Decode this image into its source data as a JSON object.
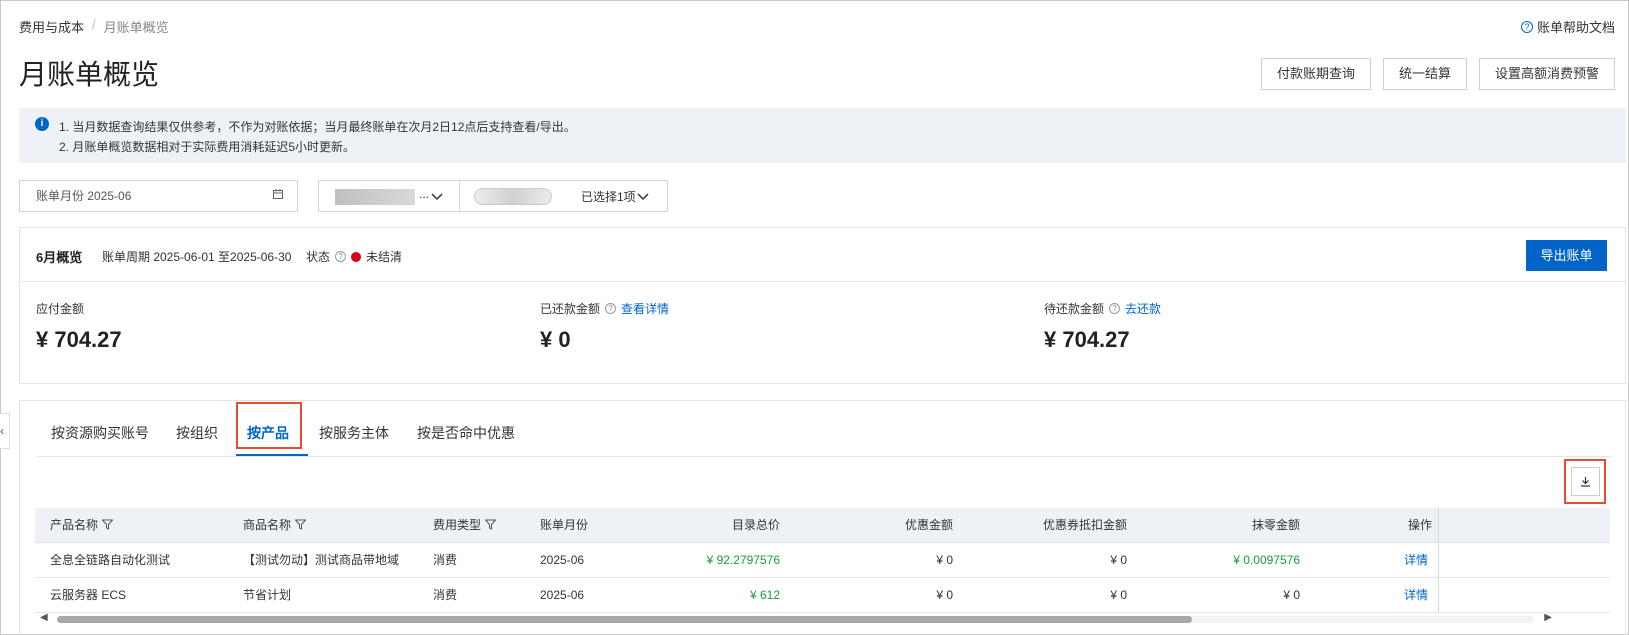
{
  "breadcrumb": {
    "root": "费用与成本",
    "separator": "/",
    "current": "月账单概览"
  },
  "help_doc": "账单帮助文档",
  "page_title": "月账单概览",
  "actions": {
    "payment_period": "付款账期查询",
    "unified_settlement": "统一结算",
    "high_spend_alert": "设置高额消费预警"
  },
  "notice": {
    "line1": "1. 当月数据查询结果仅供参考，不作为对账依据；当月最终账单在次月2日12点后支持查看/导出。",
    "line2": "2. 月账单概览数据相对于实际费用消耗延迟5小时更新。"
  },
  "filters": {
    "bill_month": "账单月份 2025-06",
    "combo_ellipsis": "...",
    "selected": "已选择1项"
  },
  "overview": {
    "title": "6月概览",
    "period": "账单周期 2025-06-01 至2025-06-30",
    "status_label": "状态",
    "status_value": "未结清",
    "export_button": "导出账单",
    "payable_label": "应付金额",
    "payable_value": "¥ 704.27",
    "paid_label": "已还款金额",
    "paid_link": "查看详情",
    "paid_value": "¥ 0",
    "pending_label": "待还款金额",
    "pending_link": "去还款",
    "pending_value": "¥ 704.27"
  },
  "tabs": [
    {
      "label": "按资源购买账号",
      "active": false
    },
    {
      "label": "按组织",
      "active": false
    },
    {
      "label": "按产品",
      "active": true
    },
    {
      "label": "按服务主体",
      "active": false
    },
    {
      "label": "按是否命中优惠",
      "active": false
    }
  ],
  "table": {
    "columns": [
      "产品名称",
      "商品名称",
      "费用类型",
      "账单月份",
      "目录总价",
      "优惠金额",
      "优惠券抵扣金额",
      "抹零金额",
      "操作"
    ],
    "rows": [
      {
        "product": "全息全链路自动化测试",
        "item": "【测试勿动】测试商品带地域",
        "fee_type": "消费",
        "month": "2025-06",
        "list_price": "¥ 92.2797576",
        "discount": "¥ 0",
        "coupon": "¥ 0",
        "rounding": "¥ 0.0097576",
        "op": "详情"
      },
      {
        "product": "云服务器 ECS",
        "item": "节省计划",
        "fee_type": "消费",
        "month": "2025-06",
        "list_price": "¥ 612",
        "discount": "¥ 0",
        "coupon": "¥ 0",
        "rounding": "¥ 0",
        "op": "详情"
      }
    ]
  },
  "icons": {
    "info": "info-icon",
    "help": "question-circle-icon",
    "calendar": "calendar-icon",
    "chevron": "chevron-down-icon",
    "download": "download-icon",
    "filter": "filter-funnel-icon"
  },
  "colors": {
    "accent": "#0064c8",
    "status_unpaid": "#d9001b",
    "amount_green": "#1a9c3c",
    "highlight": "#e2502f"
  }
}
